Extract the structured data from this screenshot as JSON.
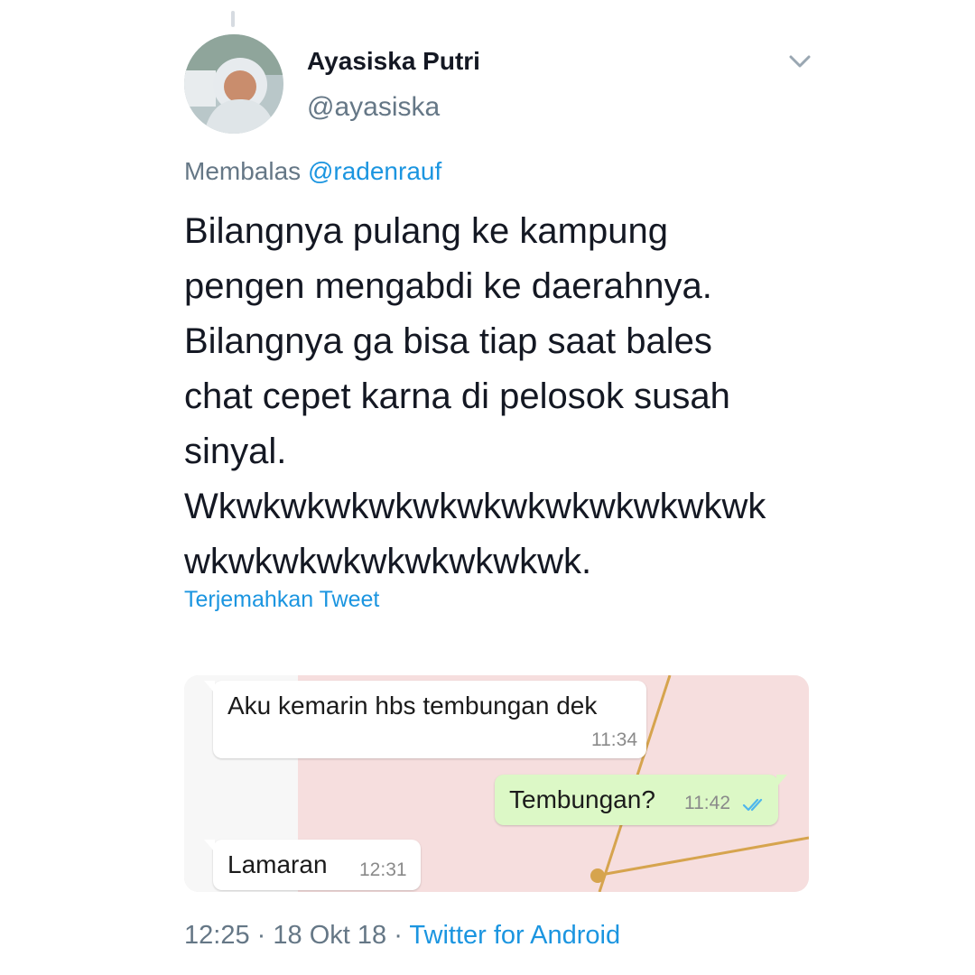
{
  "tweet": {
    "author": {
      "name": "Ayasiska Putri",
      "handle": "@ayasiska"
    },
    "reply": {
      "prefix": "Membalas",
      "mention": "@radenrauf"
    },
    "text_lines": [
      "Bilangnya pulang ke kampung",
      "pengen mengabdi ke daerahnya.",
      "Bilangnya ga bisa tiap saat bales",
      "chat cepet karna di pelosok susah",
      "sinyal.",
      "Wkwkwkwkwkwkwkwkwkwkwkwkwk",
      "wkwkwkwkwkwkwkwkwk."
    ],
    "translate_label": "Terjemahkan Tweet",
    "meta": {
      "time": "12:25",
      "date": "18 Okt 18",
      "separator": "·",
      "source": "Twitter for Android"
    },
    "icons": {
      "more": "chevron-down-icon",
      "read_receipt": "double-check-icon"
    },
    "colors": {
      "link": "#1b95e0",
      "secondary": "#657786",
      "text": "#141823",
      "outgoing_bubble": "#dcf8c6",
      "chat_background": "#f6dede"
    }
  },
  "chat": {
    "messages": [
      {
        "direction": "incoming",
        "text": "Aku kemarin hbs tembungan dek",
        "time": "11:34"
      },
      {
        "direction": "outgoing",
        "text": "Tembungan?",
        "time": "11:42"
      },
      {
        "direction": "incoming",
        "text": "Lamaran",
        "time": "12:31"
      }
    ]
  }
}
